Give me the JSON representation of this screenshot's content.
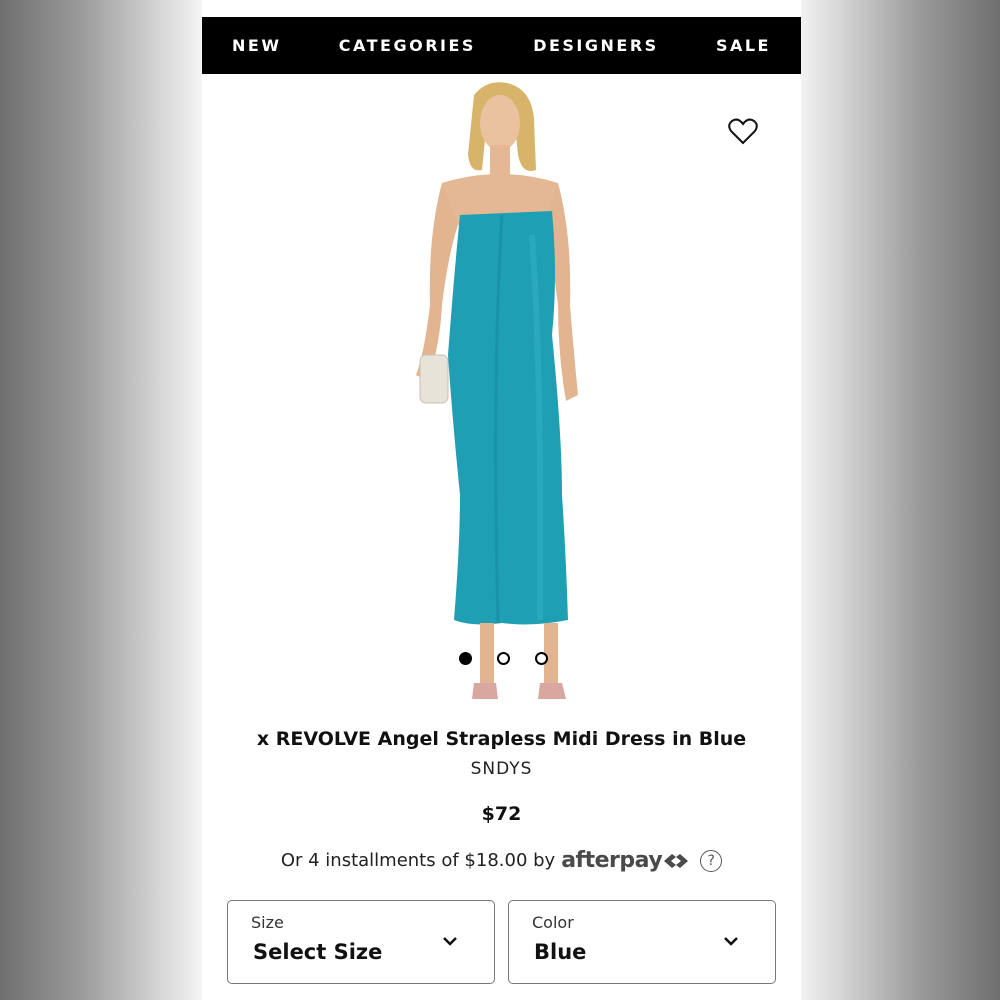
{
  "nav": {
    "items": [
      "NEW",
      "CATEGORIES",
      "DESIGNERS",
      "SALE"
    ]
  },
  "product": {
    "image_alt": "Model wearing teal satin strapless midi dress",
    "title": "x REVOLVE Angel Strapless Midi Dress in Blue",
    "brand": "SNDYS",
    "price": "$72",
    "afterpay_text": "Or 4 installments of $18.00 by",
    "afterpay_brand": "afterpay",
    "help_symbol": "?",
    "image_count": 3,
    "active_image": 1
  },
  "selectors": {
    "size": {
      "label": "Size",
      "value": "Select Size"
    },
    "color": {
      "label": "Color",
      "value": "Blue"
    }
  },
  "colors": {
    "nav_bg": "#000000",
    "dress": "#1f9fb3",
    "accent_text": "#111111"
  },
  "icons": [
    "heart-icon",
    "chevron-down-icon",
    "help-icon",
    "afterpay-arrows-icon"
  ]
}
